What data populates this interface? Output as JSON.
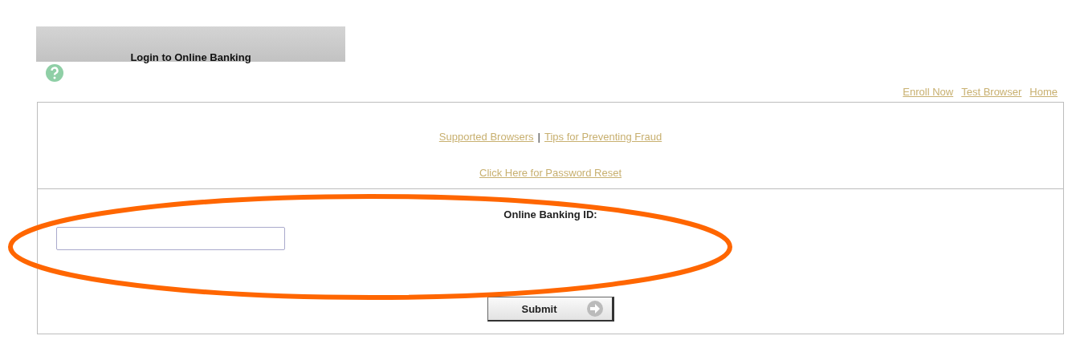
{
  "header": {
    "title": "Login to Online Banking"
  },
  "top_links": [
    "Enroll Now",
    "Test Browser",
    "Home"
  ],
  "panel": {
    "links": [
      "Supported Browsers",
      "Tips for Preventing Fraud"
    ],
    "separator": "|",
    "reset_link": "Click Here for Password Reset",
    "field_label": "Online Banking ID:",
    "submit": "Submit"
  },
  "annotation": {
    "kind": "ellipse",
    "color": "#ff6600"
  }
}
